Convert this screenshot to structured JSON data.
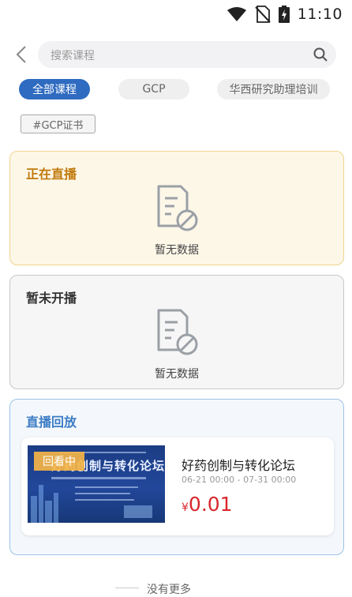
{
  "status_bar": {
    "time": "11:10",
    "icons": [
      "wifi-icon",
      "no-sim-icon",
      "battery-charging-icon"
    ]
  },
  "search": {
    "placeholder": "搜索课程",
    "back_icon": "chevron-left-icon",
    "search_icon": "search-icon"
  },
  "categories": [
    {
      "label": "全部课程",
      "active": true
    },
    {
      "label": "GCP",
      "active": false
    },
    {
      "label": "华西研究助理培训",
      "active": false
    }
  ],
  "tag": "#GCP证书",
  "sections": {
    "live": {
      "title": "正在直播",
      "empty_text": "暂无数据"
    },
    "upcoming": {
      "title": "暂未开播",
      "empty_text": "暂无数据"
    },
    "replay": {
      "title": "直播回放"
    }
  },
  "course": {
    "badge": "回看中",
    "thumb_title": "好药创制与转化论坛",
    "name": "好药创制与转化论坛",
    "time": "06-21 00:00 - 07-31 00:00",
    "price_symbol": "¥",
    "price": "0.01"
  },
  "footer": {
    "text": "没有更多"
  },
  "colors": {
    "accent": "#2f6bc0",
    "live_bg": "#fdf7e8",
    "live_border": "#f0d48d",
    "live_title": "#c07a0c",
    "replay_bg": "#f4f8fc",
    "replay_border": "#9cc3e7",
    "replay_title": "#3b7cc4",
    "price": "#d8282d"
  }
}
